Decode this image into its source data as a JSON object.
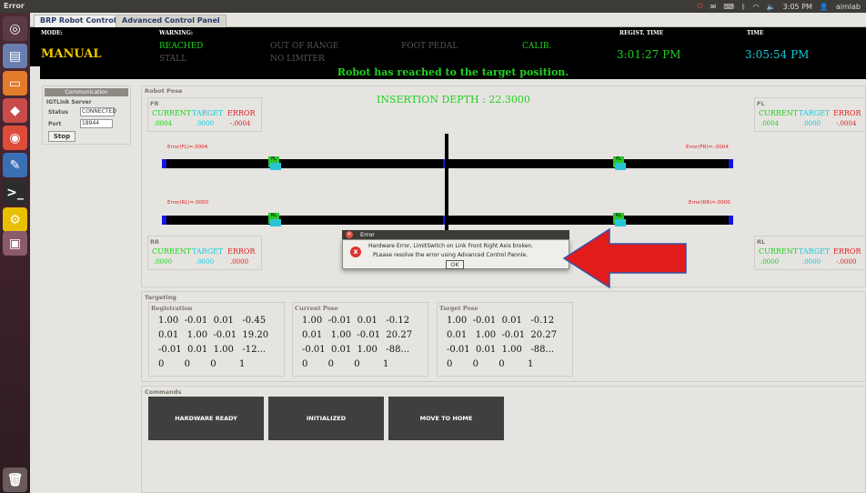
{
  "topbar": {
    "window_title": "Error",
    "time": "3:05 PM",
    "user": "aimlab"
  },
  "tabs": [
    {
      "label": "BRP Robot Controller"
    },
    {
      "label": "Advanced Control Panel"
    }
  ],
  "status": {
    "mode_label": "MODE:",
    "mode_value": "MANUAL",
    "warning_label": "WARNING:",
    "reached": "REACHED",
    "stall": "STALL",
    "out_of_range": "OUT OF RANGE",
    "no_limiter": "NO LIMITER",
    "foot_pedal": "FOOT PEDAL",
    "calib": "CALIB.",
    "regist_time_label": "REGIST. TIME",
    "regist_time": "3:01:27 PM",
    "time_label": "TIME",
    "time": "3:05:54 PM"
  },
  "message": "Robot has reached to the target position.",
  "comm": {
    "header": "Communication",
    "title": "IGTLink Server",
    "status_label": "Status",
    "status_value": "CONNECTED",
    "port_label": "Port",
    "port_value": "18944",
    "stop": "Stop"
  },
  "pose": {
    "title": "Robot Pose",
    "insertion": "INSERTION DEPTH : 22.3000",
    "cur": "CURRENT",
    "tgt": "TARGET",
    "err": "ERROR",
    "fr": {
      "name": "FR",
      "current": ".0004",
      "target": ".0000",
      "error": "-.0004"
    },
    "fl": {
      "name": "FL",
      "current": ".0004",
      "target": ".0000",
      "error": "-.0004"
    },
    "rr": {
      "name": "RR",
      "current": ".0000",
      "target": ".0000",
      "error": ".0000"
    },
    "rl": {
      "name": "RL",
      "current": ".0000",
      "target": ".0000",
      "error": "-.0000"
    },
    "err_fl": "Error(FL)=.0004",
    "err_fr": "Error(FR)=-.0004",
    "err_rl": "Error(RL)=.0000",
    "err_rr": "Error(RR)=.0000"
  },
  "targeting": {
    "title": "Targeting",
    "registration": {
      "title": "Registration",
      "rows": [
        "1.00  -0.01  0.01   -0.45",
        "0.01   1.00  -0.01  19.20",
        "-0.01  0.01  1.00   -12...",
        "0       0       0        1"
      ]
    },
    "current": {
      "title": "Current Pose",
      "rows": [
        "1.00  -0.01  0.01   -0.12",
        "0.01   1.00  -0.01  20.27",
        "-0.01  0.01  1.00   -88...",
        "0       0       0        1"
      ]
    },
    "target": {
      "title": "Target Pose",
      "rows": [
        "1.00  -0.01  0.01   -0.12",
        "0.01   1.00  -0.01  20.27",
        "-0.01  0.01  1.00   -88...",
        "0       0       0        1"
      ]
    }
  },
  "commands": {
    "title": "Commands",
    "hardware_ready": "HARDWARE READY",
    "initialized": "INITIALIZED",
    "move_home": "MOVE TO HOME"
  },
  "dialog": {
    "title": "Error",
    "line1": "Hardware Error, LimitSwitch on Link Front Right Axis broken.",
    "line2": "PLease resolve the error using Advanced Control Pannle.",
    "ok": "OK"
  },
  "colors": {
    "green": "#1ed21e",
    "cyan": "#16c8d8",
    "red": "#e02020",
    "yellow": "#f0c800"
  }
}
